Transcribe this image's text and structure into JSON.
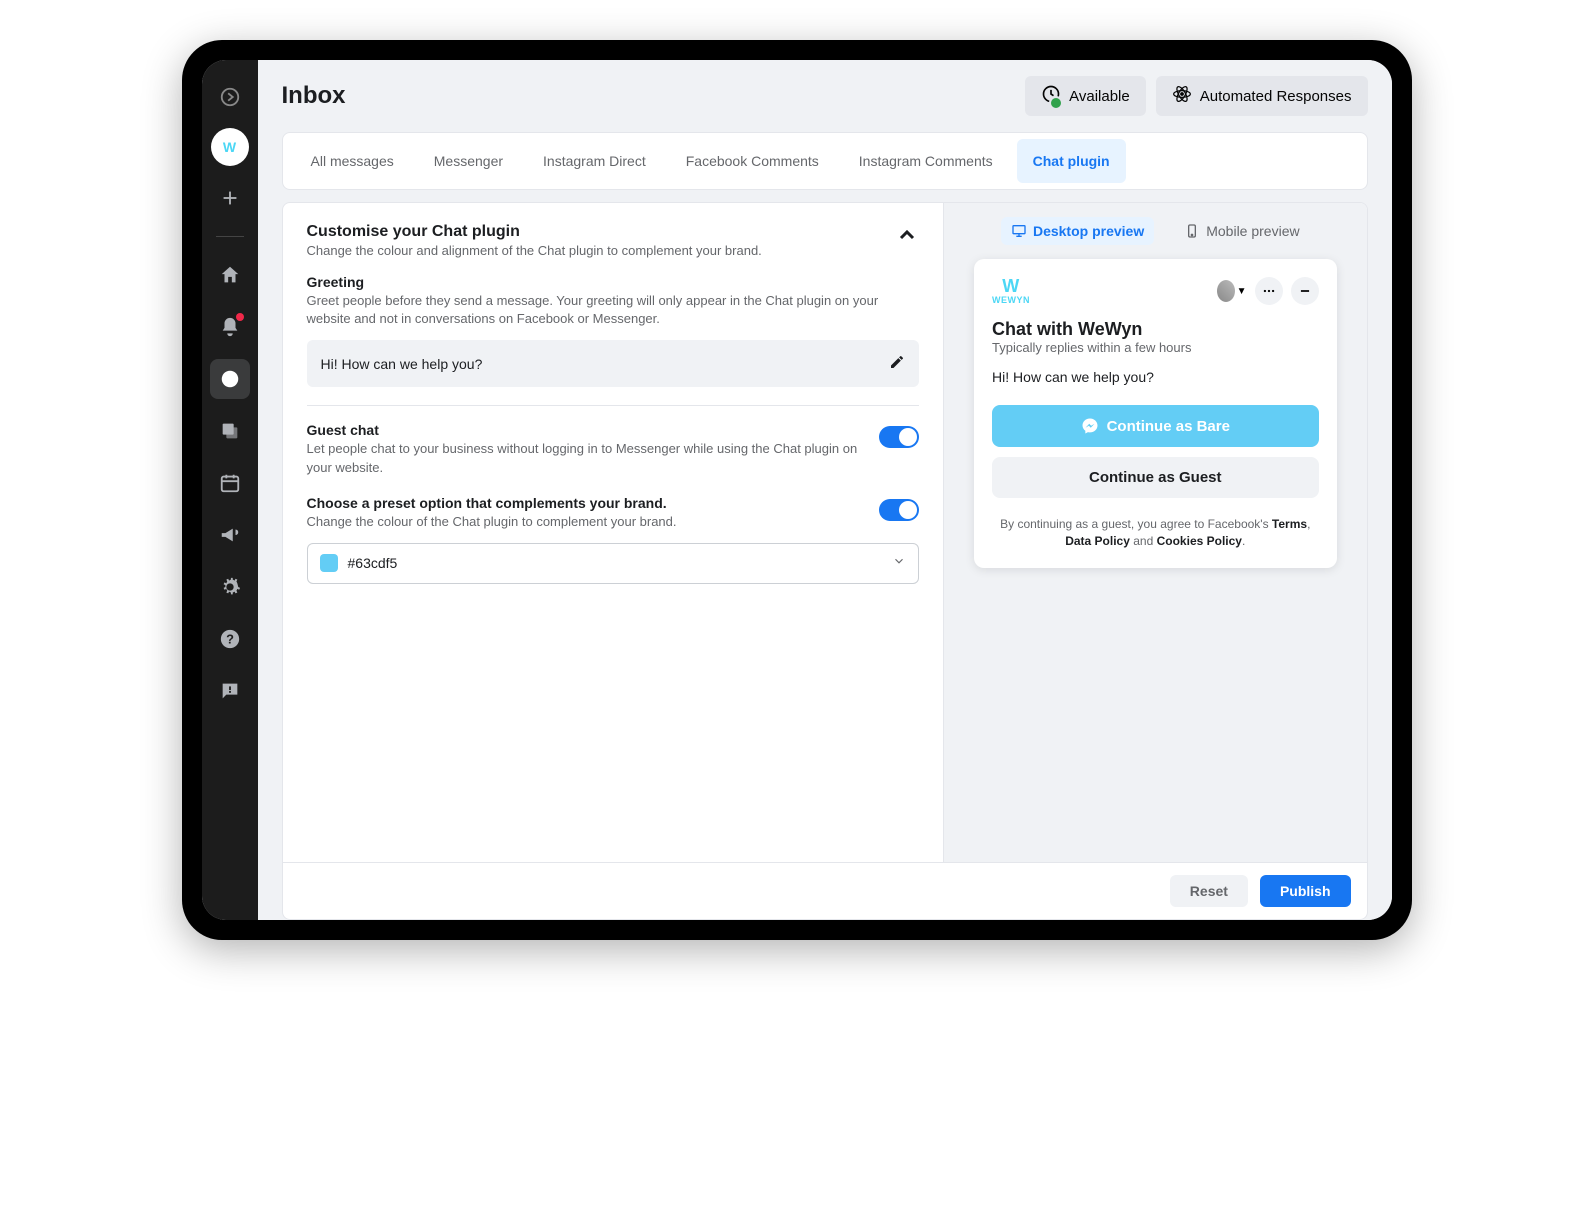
{
  "header": {
    "title": "Inbox",
    "available_label": "Available",
    "automated_label": "Automated Responses"
  },
  "tabs": [
    "All messages",
    "Messenger",
    "Instagram Direct",
    "Facebook Comments",
    "Instagram Comments",
    "Chat plugin"
  ],
  "section": {
    "title": "Customise your Chat plugin",
    "subtitle": "Change the colour and alignment of the Chat plugin to complement your brand."
  },
  "greeting": {
    "title": "Greeting",
    "desc": "Greet people before they send a message. Your greeting will only appear in the Chat plugin on your website and not in conversations on Facebook or Messenger.",
    "value": "Hi! How can we help you?"
  },
  "guest": {
    "title": "Guest chat",
    "desc": "Let people chat to your business without logging in to Messenger while using the Chat plugin on your website."
  },
  "preset": {
    "title": "Choose a preset option that complements your brand.",
    "desc": "Change the colour of the Chat plugin to complement your brand.",
    "hex": "#63cdf5"
  },
  "preview": {
    "desktop": "Desktop preview",
    "mobile": "Mobile preview",
    "chat_title": "Chat with WeWyn",
    "chat_sub": "Typically replies within a few hours",
    "chat_greeting": "Hi! How can we help you?",
    "continue_primary": "Continue as Bare",
    "continue_guest": "Continue as Guest",
    "legal_pre": "By continuing as a guest, you agree to Facebook's ",
    "terms": "Terms",
    "data_policy": "Data Policy",
    "and": " and ",
    "cookies": "Cookies Policy",
    "brand": "WeWyn"
  },
  "footer": {
    "reset": "Reset",
    "publish": "Publish"
  },
  "colors": {
    "accent": "#63cdf5"
  }
}
